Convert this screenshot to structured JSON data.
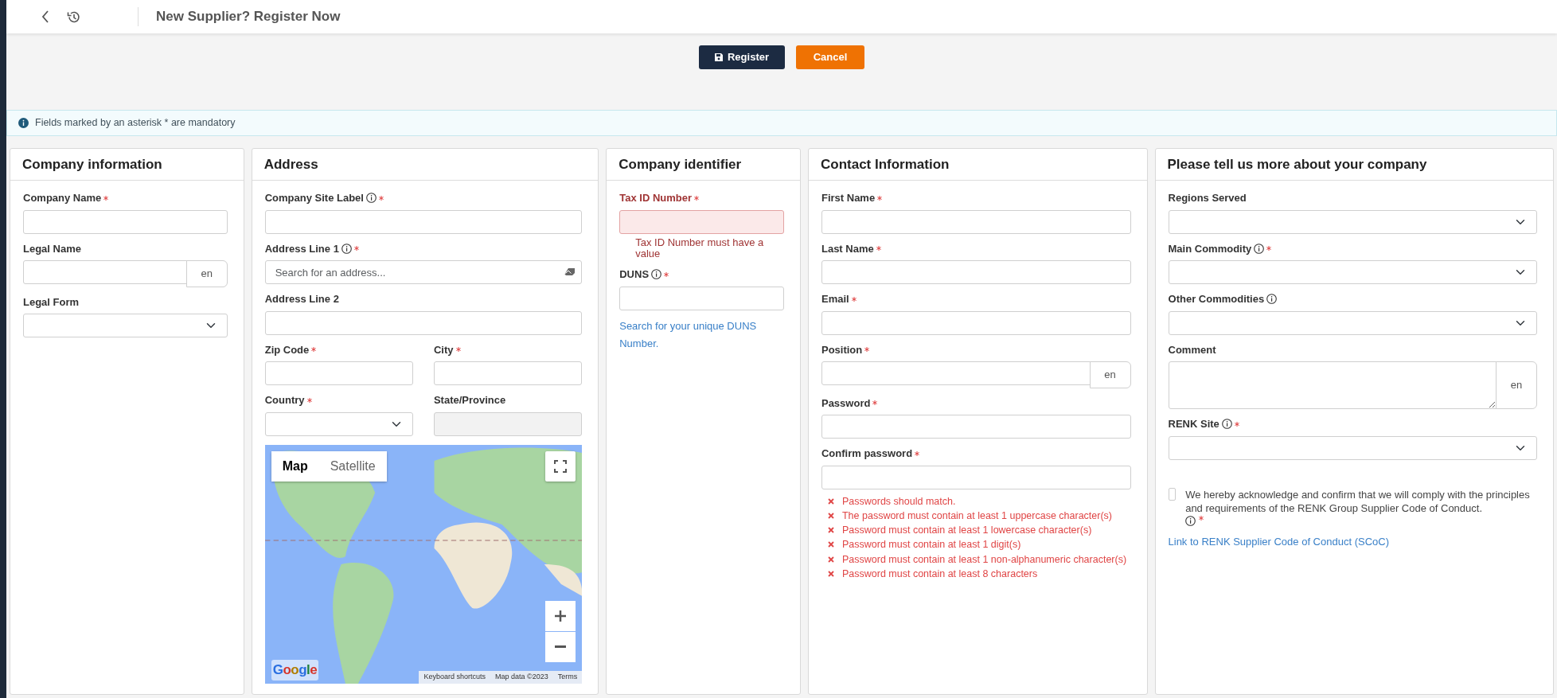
{
  "header": {
    "title": "New Supplier? Register Now"
  },
  "actions": [
    {
      "label": "Register",
      "kind": "primary"
    },
    {
      "label": "Cancel",
      "kind": "secondary"
    }
  ],
  "notice": "Fields marked by an asterisk * are mandatory",
  "sections": [
    {
      "title": "Company information",
      "items": [
        {
          "kind": "text",
          "label": "Company Name",
          "required": true,
          "info": false
        },
        {
          "kind": "lang",
          "label": "Legal Name",
          "required": false,
          "info": false,
          "lang": "en"
        },
        {
          "kind": "select",
          "label": "Legal Form",
          "required": false,
          "info": false
        }
      ]
    },
    {
      "title": "Address",
      "items": [
        {
          "kind": "text",
          "label": "Company Site Label",
          "required": true,
          "info": true
        },
        {
          "kind": "search",
          "label": "Address Line 1",
          "required": true,
          "info": true,
          "placeholder": "Search for an address..."
        },
        {
          "kind": "text",
          "label": "Address Line 2",
          "required": false,
          "info": false
        },
        {
          "kind": "row",
          "items": [
            {
              "kind": "text",
              "label": "Zip Code",
              "required": true,
              "info": false
            },
            {
              "kind": "text",
              "label": "City",
              "required": true,
              "info": false
            }
          ]
        },
        {
          "kind": "row",
          "items": [
            {
              "kind": "select",
              "label": "Country",
              "required": true,
              "info": false
            },
            {
              "kind": "readonly",
              "label": "State/Province",
              "required": false,
              "info": false
            }
          ]
        },
        {
          "kind": "map",
          "map_types": [
            {
              "label": "Map",
              "selected": true
            },
            {
              "label": "Satellite",
              "selected": false
            }
          ],
          "logo": "Google",
          "attribution": [
            "Keyboard shortcuts",
            "Map data ©2023",
            "Terms"
          ]
        }
      ]
    },
    {
      "title": "Company identifier",
      "items": [
        {
          "kind": "text",
          "label": "Tax ID Number",
          "required": true,
          "info": false,
          "error": "Tax ID Number must have a value"
        },
        {
          "kind": "text",
          "label": "DUNS",
          "required": true,
          "info": true
        },
        {
          "kind": "link",
          "text": "Search for your unique DUNS Number."
        }
      ]
    },
    {
      "title": "Contact Information",
      "items": [
        {
          "kind": "text",
          "label": "First Name",
          "required": true,
          "info": false
        },
        {
          "kind": "text",
          "label": "Last Name",
          "required": true,
          "info": false
        },
        {
          "kind": "text",
          "label": "Email",
          "required": true,
          "info": false
        },
        {
          "kind": "lang",
          "label": "Position",
          "required": true,
          "info": false,
          "lang": "en"
        },
        {
          "kind": "password",
          "label": "Password",
          "required": true,
          "info": false
        },
        {
          "kind": "password",
          "label": "Confirm password",
          "required": true,
          "info": false
        },
        {
          "kind": "rules",
          "messages": [
            "Passwords should match.",
            "The password must contain at least 1 uppercase character(s)",
            "Password must contain at least 1 lowercase character(s)",
            "Password must contain at least 1 digit(s)",
            "Password must contain at least 1 non-alphanumeric character(s)",
            "Password must contain at least 8 characters"
          ]
        }
      ]
    },
    {
      "title": "Please tell us more about your company",
      "items": [
        {
          "kind": "select",
          "label": "Regions Served",
          "required": false,
          "info": false
        },
        {
          "kind": "select",
          "label": "Main Commodity",
          "required": true,
          "info": true
        },
        {
          "kind": "select",
          "label": "Other Commodities",
          "required": false,
          "info": true
        },
        {
          "kind": "textarea",
          "label": "Comment",
          "required": false,
          "info": false,
          "lang": "en"
        },
        {
          "kind": "select",
          "label": "RENK Site",
          "required": true,
          "info": true
        },
        {
          "kind": "checkbox",
          "text": "We hereby acknowledge and confirm that we will comply with the principles and requirements of the RENK Group Supplier Code of Conduct.",
          "checked": false,
          "required": true,
          "info": true
        },
        {
          "kind": "link",
          "text": "Link to RENK Supplier Code of Conduct (SCoC)"
        }
      ]
    }
  ]
}
